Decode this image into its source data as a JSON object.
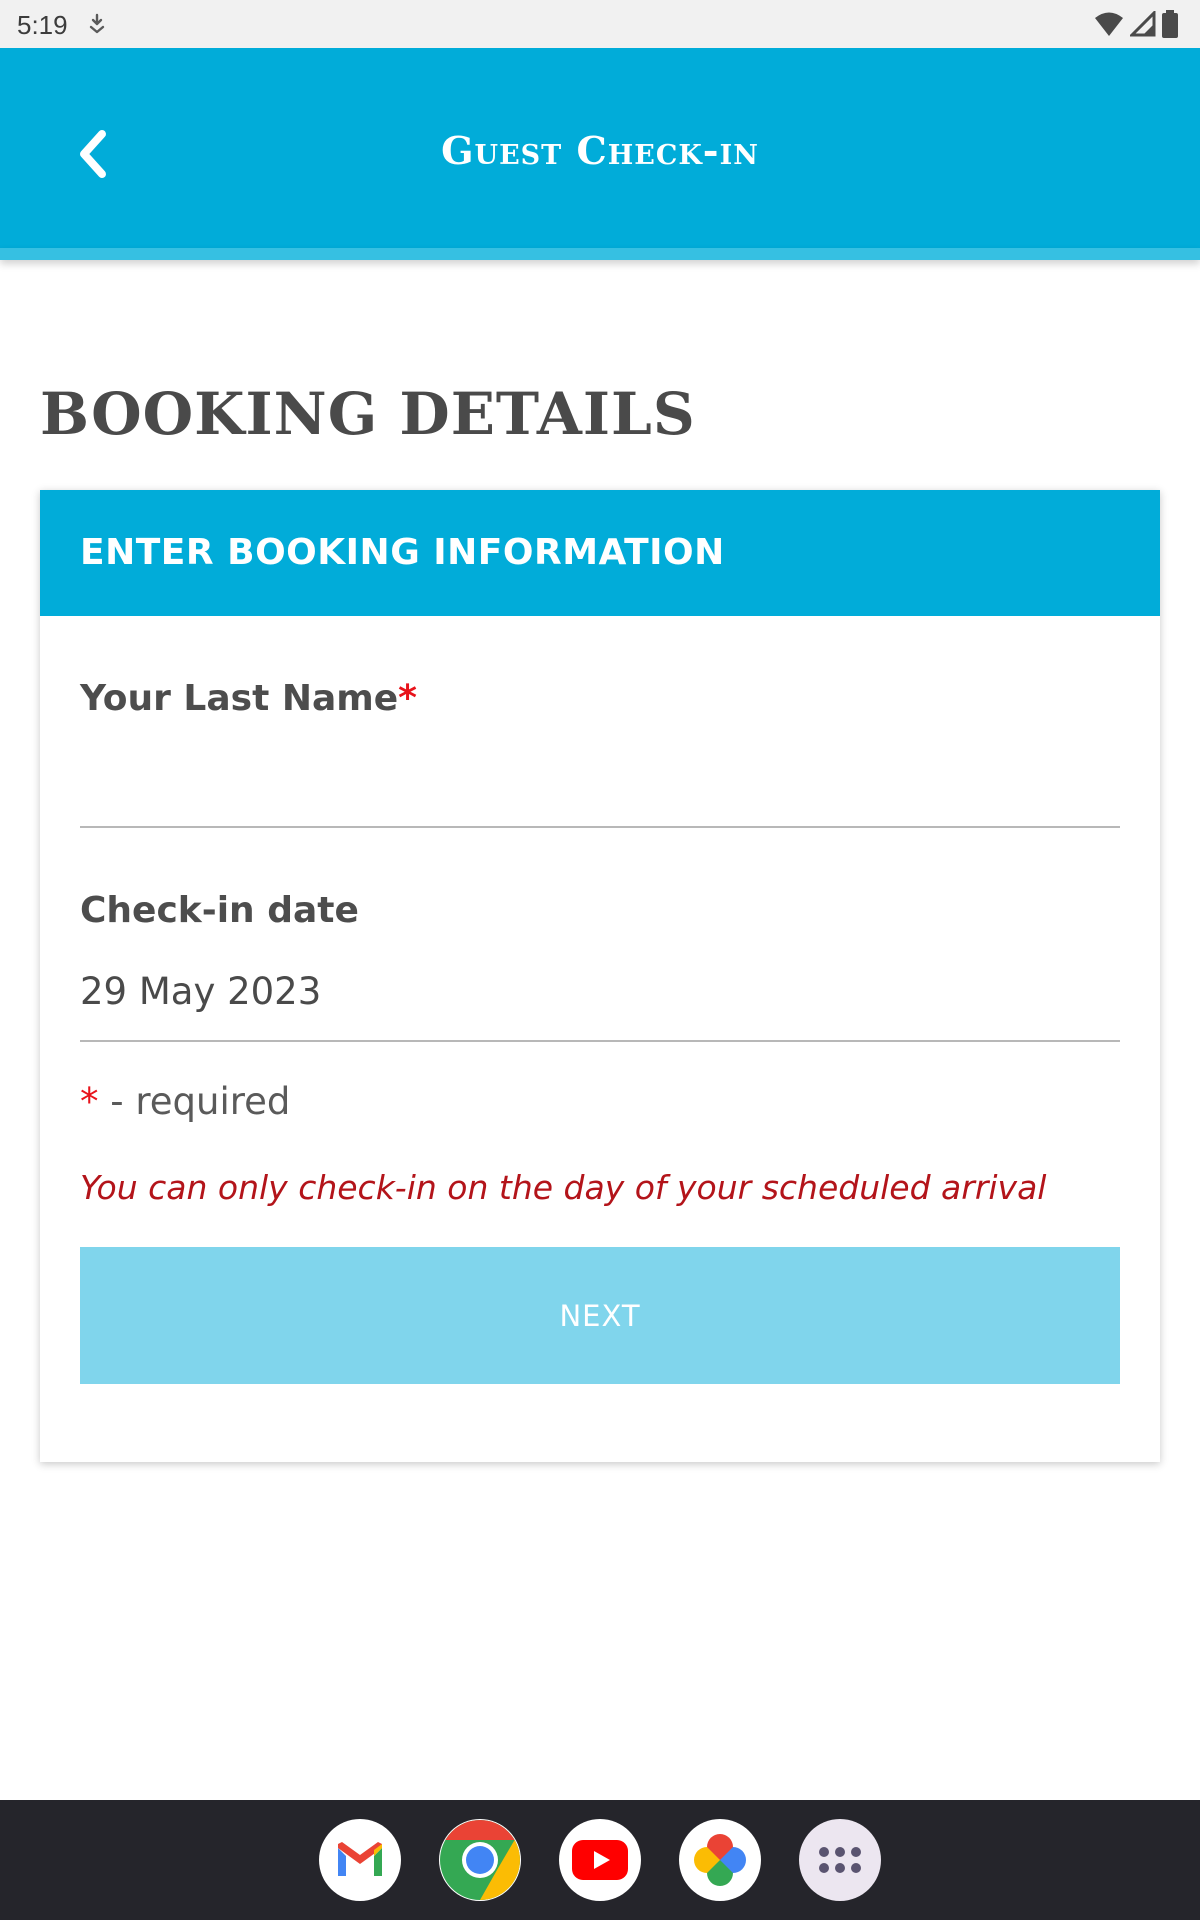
{
  "status_bar": {
    "time": "5:19"
  },
  "app_bar": {
    "title": "Guest Check-in",
    "color": "#01acd9"
  },
  "section": {
    "title": "BOOKING DETAILS"
  },
  "card": {
    "header": "ENTER BOOKING INFORMATION",
    "last_name": {
      "label": "Your Last Name",
      "required_mark": "*",
      "value": ""
    },
    "checkin": {
      "label": "Check-in date",
      "value": "29 May 2023"
    },
    "required_note": {
      "star": "*",
      "text": " - required"
    },
    "warning": "You can only check-in on the day of your scheduled arrival",
    "next_button": "NEXT"
  },
  "dock": {
    "apps": [
      "gmail-icon",
      "chrome-icon",
      "youtube-icon",
      "photos-icon",
      "app-drawer-icon"
    ]
  }
}
